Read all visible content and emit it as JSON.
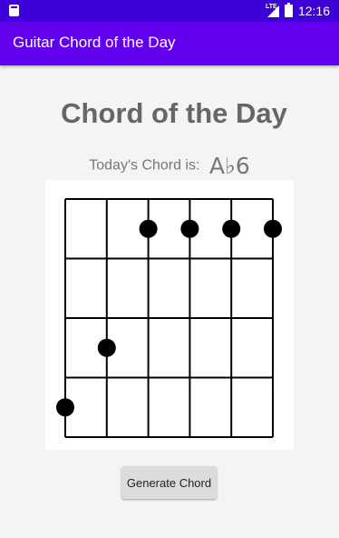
{
  "status_bar": {
    "network_label": "LTE",
    "time": "12:16",
    "icons": [
      "sd-card-icon",
      "signal-icon",
      "battery-icon"
    ]
  },
  "app_bar": {
    "title": "Guitar Chord of the Day",
    "color": "#6200ee"
  },
  "main": {
    "heading": "Chord of the Day",
    "chord_prefix": "Today's Chord is:",
    "chord_name": "A♭6"
  },
  "chord_diagram": {
    "strings": 6,
    "frets": 4,
    "dots": [
      {
        "string": 1,
        "fret": 4
      },
      {
        "string": 2,
        "fret": 3
      },
      {
        "string": 3,
        "fret": 1
      },
      {
        "string": 4,
        "fret": 1
      },
      {
        "string": 5,
        "fret": 1
      },
      {
        "string": 6,
        "fret": 1
      }
    ]
  },
  "button": {
    "label": "Generate Chord"
  }
}
